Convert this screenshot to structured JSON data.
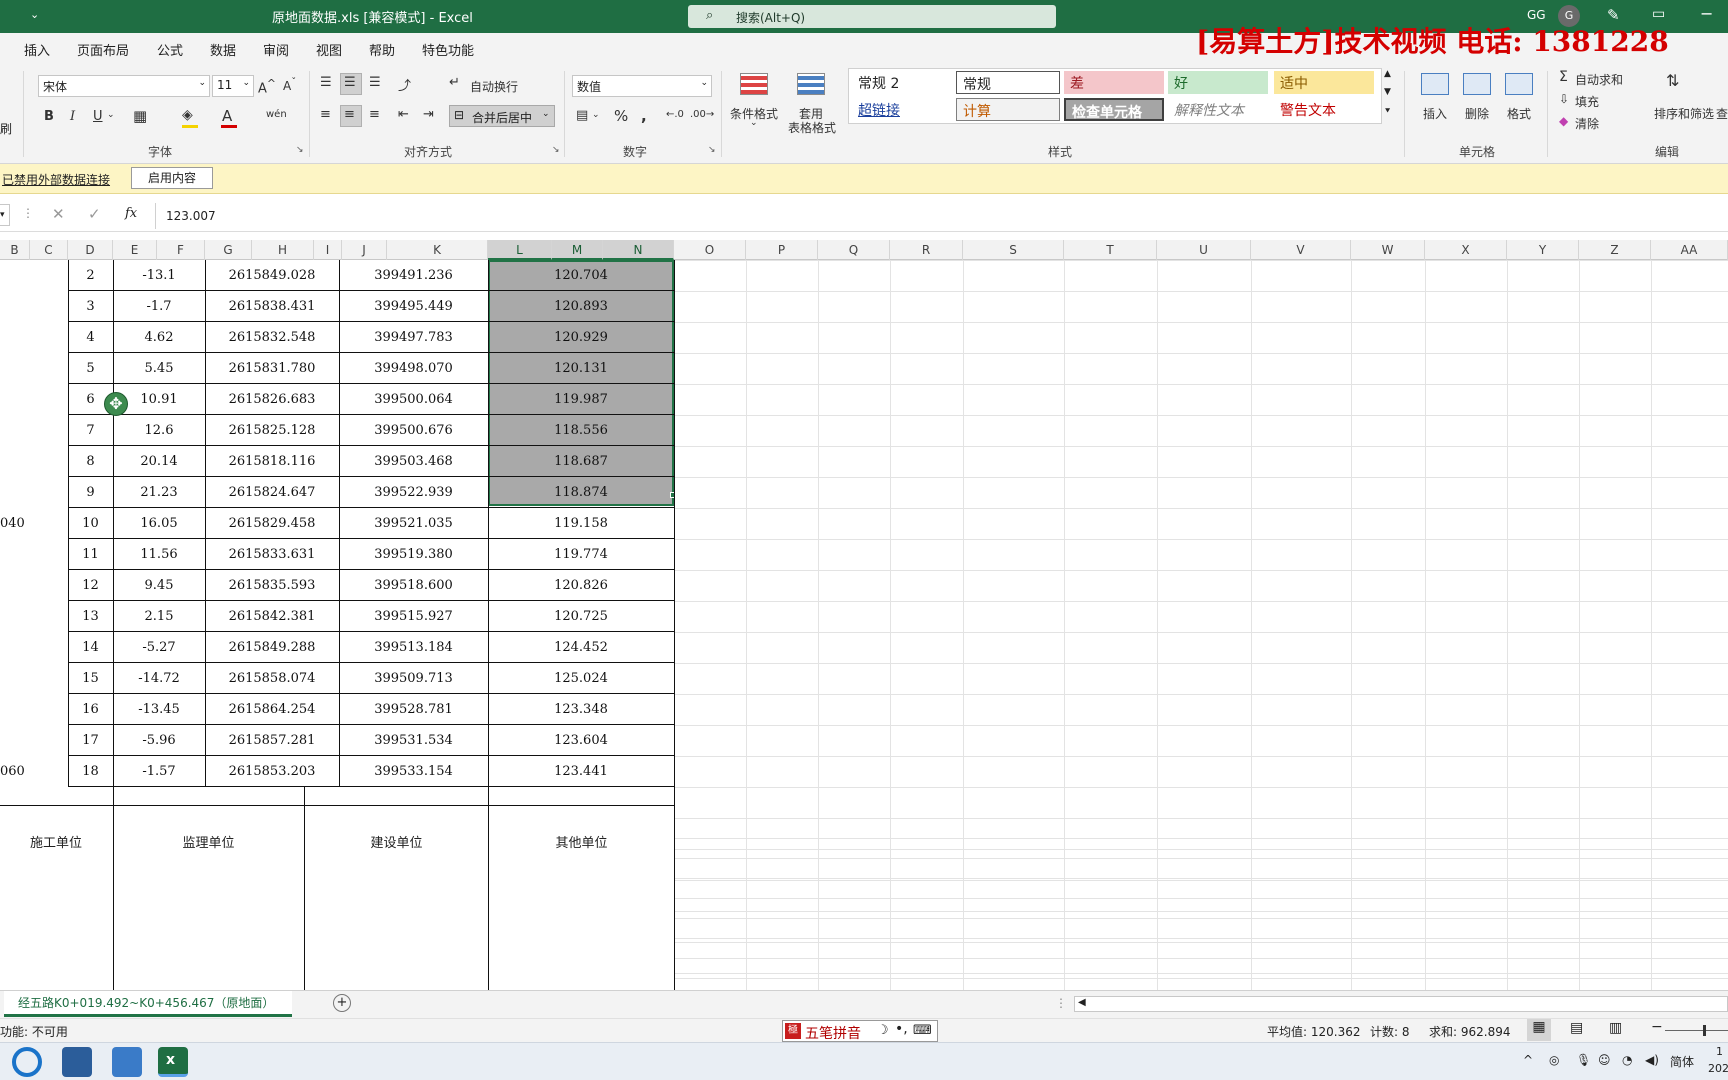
{
  "titlebar": {
    "title": "原地面数据.xls  [兼容模式]  -  Excel",
    "search_placeholder": "搜索(Alt+Q)",
    "user": "GG",
    "avatar_letter": "G",
    "watermark": "[易算土方]技术视频 电话: 1381228"
  },
  "menu": {
    "items": [
      "插入",
      "页面布局",
      "公式",
      "数据",
      "审阅",
      "视图",
      "帮助",
      "特色功能"
    ],
    "partial_left": "刷"
  },
  "ribbon": {
    "font_name": "宋体",
    "font_size": "11",
    "font_group": "字体",
    "align_group": "对齐方式",
    "wrap_text": "自动换行",
    "merge_center": "合并后居中",
    "number_format": "数值",
    "number_group": "数字",
    "cond_format": "条件格式",
    "table_format_1": "套用",
    "table_format_2": "表格格式",
    "styles_group": "样式",
    "style_cells": [
      {
        "label": "常规 2"
      },
      {
        "label": "常规"
      },
      {
        "label": "差"
      },
      {
        "label": "好"
      },
      {
        "label": "适中"
      },
      {
        "label": "超链接"
      },
      {
        "label": "计算"
      },
      {
        "label": "检查单元格"
      },
      {
        "label": "解释性文本"
      },
      {
        "label": "警告文本"
      }
    ],
    "insert": "插入",
    "delete": "删除",
    "format": "格式",
    "cells_group": "单元格",
    "autosum": "自动求和",
    "fill": "填充",
    "clear": "清除",
    "sort_filter": "排序和筛选",
    "find_partial": "查",
    "edit_group": "编辑"
  },
  "msgbar": {
    "text": "已禁用外部数据连接",
    "button": "启用内容"
  },
  "formula_bar": {
    "fx": "fx",
    "value": "123.007"
  },
  "columns": [
    "B",
    "C",
    "D",
    "E",
    "F",
    "G",
    "H",
    "I",
    "J",
    "K",
    "L",
    "M",
    "N",
    "O",
    "P",
    "Q",
    "R",
    "S",
    "T",
    "U",
    "V",
    "W",
    "X",
    "Y",
    "Z",
    "AA"
  ],
  "rows": [
    {
      "b": "",
      "d": "2",
      "e": "-13.1",
      "g": "2615849.028",
      "k": "399491.236",
      "m": "120.704"
    },
    {
      "b": "",
      "d": "3",
      "e": "-1.7",
      "g": "2615838.431",
      "k": "399495.449",
      "m": "120.893"
    },
    {
      "b": "",
      "d": "4",
      "e": "4.62",
      "g": "2615832.548",
      "k": "399497.783",
      "m": "120.929"
    },
    {
      "b": "",
      "d": "5",
      "e": "5.45",
      "g": "2615831.780",
      "k": "399498.070",
      "m": "120.131"
    },
    {
      "b": "",
      "d": "6",
      "e": "10.91",
      "g": "2615826.683",
      "k": "399500.064",
      "m": "119.987"
    },
    {
      "b": "",
      "d": "7",
      "e": "12.6",
      "g": "2615825.128",
      "k": "399500.676",
      "m": "118.556"
    },
    {
      "b": "",
      "d": "8",
      "e": "20.14",
      "g": "2615818.116",
      "k": "399503.468",
      "m": "118.687"
    },
    {
      "b": "",
      "d": "9",
      "e": "21.23",
      "g": "2615824.647",
      "k": "399522.939",
      "m": "118.874"
    },
    {
      "b": "040",
      "d": "10",
      "e": "16.05",
      "g": "2615829.458",
      "k": "399521.035",
      "m": "119.158"
    },
    {
      "b": "",
      "d": "11",
      "e": "11.56",
      "g": "2615833.631",
      "k": "399519.380",
      "m": "119.774"
    },
    {
      "b": "",
      "d": "12",
      "e": "9.45",
      "g": "2615835.593",
      "k": "399518.600",
      "m": "120.826"
    },
    {
      "b": "",
      "d": "13",
      "e": "2.15",
      "g": "2615842.381",
      "k": "399515.927",
      "m": "120.725"
    },
    {
      "b": "",
      "d": "14",
      "e": "-5.27",
      "g": "2615849.288",
      "k": "399513.184",
      "m": "124.452"
    },
    {
      "b": "",
      "d": "15",
      "e": "-14.72",
      "g": "2615858.074",
      "k": "399509.713",
      "m": "125.024"
    },
    {
      "b": "",
      "d": "16",
      "e": "-13.45",
      "g": "2615864.254",
      "k": "399528.781",
      "m": "123.348"
    },
    {
      "b": "",
      "d": "17",
      "e": "-5.96",
      "g": "2615857.281",
      "k": "399531.534",
      "m": "123.604"
    },
    {
      "b": "060",
      "d": "18",
      "e": "-1.57",
      "g": "2615853.203",
      "k": "399533.154",
      "m": "123.441"
    }
  ],
  "footer_row": [
    "施工单位",
    "监理单位",
    "建设单位",
    "其他单位"
  ],
  "sheet_tab": "经五路K0+019.492~K0+456.467（原地面）",
  "statusbar": {
    "left": "功能: 不可用",
    "average": "平均值: 120.362",
    "count": "计数: 8",
    "sum": "求和: 962.894"
  },
  "ime": {
    "label": "五笔拼音"
  },
  "taskbar": {
    "lang": "简体",
    "clock_partial": "1",
    "date_partial": "202"
  },
  "colors": {
    "excel_green": "#1f6e43",
    "selection_fill": "#a9a9a9",
    "watermark_red": "#d40000"
  }
}
